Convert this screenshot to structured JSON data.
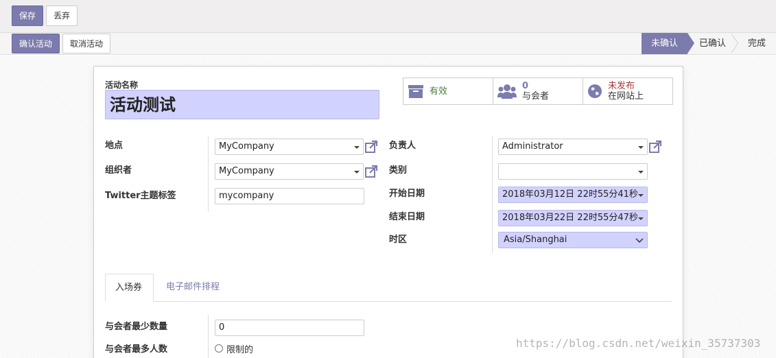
{
  "toolbar": {
    "save_label": "保存",
    "discard_label": "丢弃"
  },
  "header_buttons": {
    "confirm_label": "确认活动",
    "cancel_label": "取消活动"
  },
  "statusbar": {
    "stages": [
      "未确认",
      "已确认",
      "完成"
    ],
    "active_stage": "未确认"
  },
  "form": {
    "name_label": "活动名称",
    "name_value": "活动测试",
    "smart_buttons": {
      "active_label": "有效",
      "attendee_count": "0",
      "attendee_label": "与会者",
      "website_line1": "未发布",
      "website_line2": "在网站上"
    },
    "left_fields": {
      "location_label": "地点",
      "location_value": "MyCompany",
      "organizer_label": "组织者",
      "organizer_value": "MyCompany",
      "twitter_label": "Twitter主题标签",
      "twitter_value": "mycompany"
    },
    "right_fields": {
      "responsible_label": "负责人",
      "responsible_value": "Administrator",
      "category_label": "类别",
      "category_value": "",
      "start_label": "开始日期",
      "start_value": "2018年03月12日 22时55分41秒",
      "end_label": "结束日期",
      "end_value": "2018年03月22日 22时55分47秒",
      "tz_label": "时区",
      "tz_value": "Asia/Shanghai"
    },
    "tabs": [
      "入场券",
      "电子邮件排程"
    ],
    "bottom_fields": {
      "min_label": "与会者最少数量",
      "min_value": "0",
      "max_label": "与会者最多人数",
      "max_option": "限制的"
    }
  },
  "watermark": "https://blog.csdn.net/weixin_35737303",
  "colors": {
    "primary": "#7c7bad",
    "required_bg": "#d2d2ff",
    "active_green": "#4b7d3b",
    "unpublished_red": "#a43a3a"
  }
}
